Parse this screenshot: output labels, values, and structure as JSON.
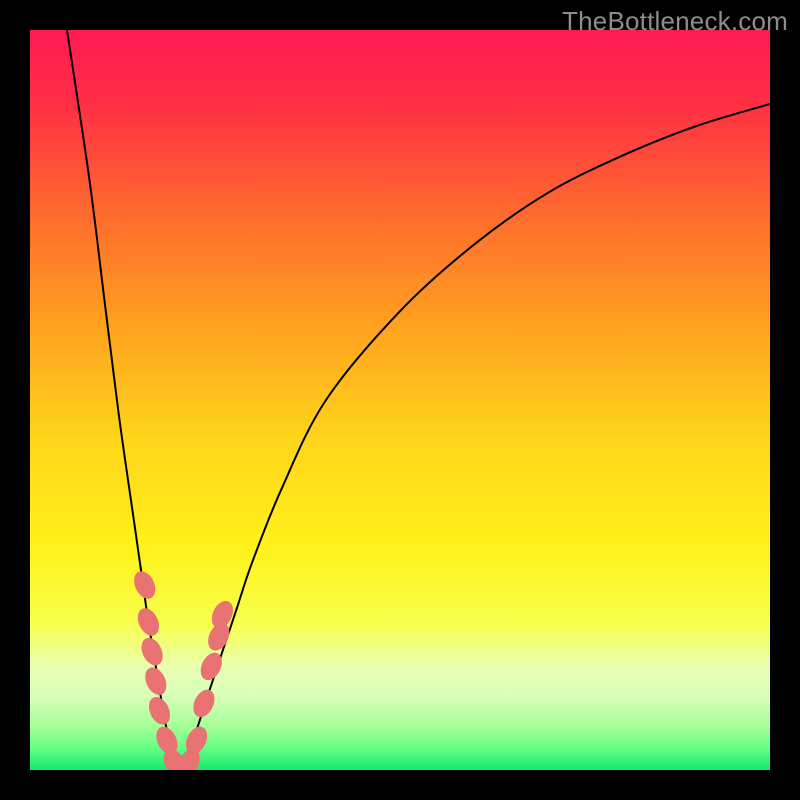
{
  "watermark": "TheBottleneck.com",
  "colors": {
    "frame": "#000000",
    "curve": "#000000",
    "blob_fill": "#e97373",
    "blob_stroke": "#e97373",
    "gradient_stops": [
      {
        "offset": 0.0,
        "color": "#ff1a53"
      },
      {
        "offset": 0.1,
        "color": "#ff2f44"
      },
      {
        "offset": 0.25,
        "color": "#ff6b2e"
      },
      {
        "offset": 0.4,
        "color": "#ffa21f"
      },
      {
        "offset": 0.55,
        "color": "#ffd41a"
      },
      {
        "offset": 0.7,
        "color": "#fff21a"
      },
      {
        "offset": 0.8,
        "color": "#f7ff4a"
      },
      {
        "offset": 0.86,
        "color": "#eaffb0"
      },
      {
        "offset": 0.9,
        "color": "#d8ffb8"
      },
      {
        "offset": 0.94,
        "color": "#a8ff9a"
      },
      {
        "offset": 0.97,
        "color": "#66ff83"
      },
      {
        "offset": 1.0,
        "color": "#17e86e"
      }
    ]
  },
  "chart_data": {
    "type": "line",
    "title": "",
    "xlabel": "",
    "ylabel": "",
    "xlim": [
      0,
      100
    ],
    "ylim": [
      0,
      100
    ],
    "note": "Two branches of a bottleneck-style curve. y≈0 (green) near x≈20; rises sharply to red toward both x→0 and x→100. Values are read off the gradient bands (0=bottom/green, 100=top/red). Pink blobs mark sampled points near the minimum.",
    "series": [
      {
        "name": "left-branch",
        "x": [
          5,
          8,
          10,
          12,
          14,
          15,
          16,
          17,
          18,
          19,
          20
        ],
        "y": [
          100,
          80,
          64,
          48,
          34,
          27,
          20,
          14,
          8,
          3,
          0
        ]
      },
      {
        "name": "right-branch",
        "x": [
          20,
          22,
          24,
          26,
          28,
          30,
          34,
          40,
          50,
          60,
          70,
          80,
          90,
          100
        ],
        "y": [
          0,
          4,
          10,
          16,
          22,
          28,
          38,
          50,
          62,
          71,
          78,
          83,
          87,
          90
        ]
      }
    ],
    "highlight_points": {
      "name": "sampled-near-minimum",
      "points": [
        {
          "x": 15.5,
          "y": 25
        },
        {
          "x": 16.0,
          "y": 20
        },
        {
          "x": 16.5,
          "y": 16
        },
        {
          "x": 17.0,
          "y": 12
        },
        {
          "x": 17.5,
          "y": 8
        },
        {
          "x": 18.5,
          "y": 4
        },
        {
          "x": 19.5,
          "y": 1
        },
        {
          "x": 20.5,
          "y": 0
        },
        {
          "x": 21.5,
          "y": 1
        },
        {
          "x": 22.5,
          "y": 4
        },
        {
          "x": 23.5,
          "y": 9
        },
        {
          "x": 24.5,
          "y": 14
        },
        {
          "x": 25.5,
          "y": 18
        },
        {
          "x": 26.0,
          "y": 21
        }
      ]
    }
  }
}
